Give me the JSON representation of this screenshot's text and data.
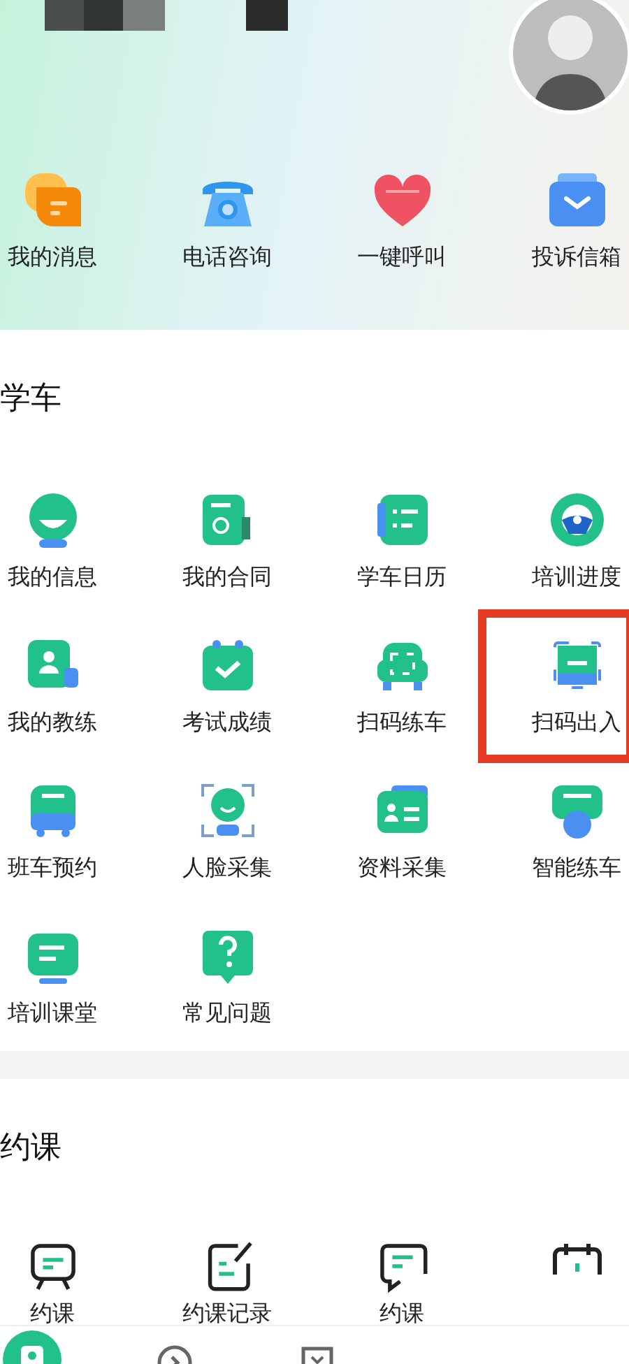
{
  "quick_actions": [
    {
      "label": "我的消息"
    },
    {
      "label": "电话咨询"
    },
    {
      "label": "一键呼叫"
    },
    {
      "label": "投诉信箱"
    }
  ],
  "sections": [
    {
      "title": "学车",
      "items": [
        {
          "label": "我的信息",
          "highlighted": false
        },
        {
          "label": "我的合同",
          "highlighted": false
        },
        {
          "label": "学车日历",
          "highlighted": false
        },
        {
          "label": "培训进度",
          "highlighted": false
        },
        {
          "label": "我的教练",
          "highlighted": false
        },
        {
          "label": "考试成绩",
          "highlighted": false
        },
        {
          "label": "扫码练车",
          "highlighted": false
        },
        {
          "label": "扫码出入",
          "highlighted": true
        },
        {
          "label": "班车预约",
          "highlighted": false
        },
        {
          "label": "人脸采集",
          "highlighted": false
        },
        {
          "label": "资料采集",
          "highlighted": false
        },
        {
          "label": "智能练车",
          "highlighted": false
        },
        {
          "label": "培训课堂",
          "highlighted": false
        },
        {
          "label": "常见问题",
          "highlighted": false
        }
      ]
    },
    {
      "title": "约课",
      "items": [
        {
          "label": "约课",
          "highlighted": false
        },
        {
          "label": "约课记录",
          "highlighted": false
        },
        {
          "label": "约课",
          "highlighted": false
        },
        {
          "highlighted": false
        }
      ]
    }
  ],
  "bottom_nav": [
    {
      "selected": true
    },
    {
      "selected": false
    },
    {
      "selected": false
    }
  ]
}
